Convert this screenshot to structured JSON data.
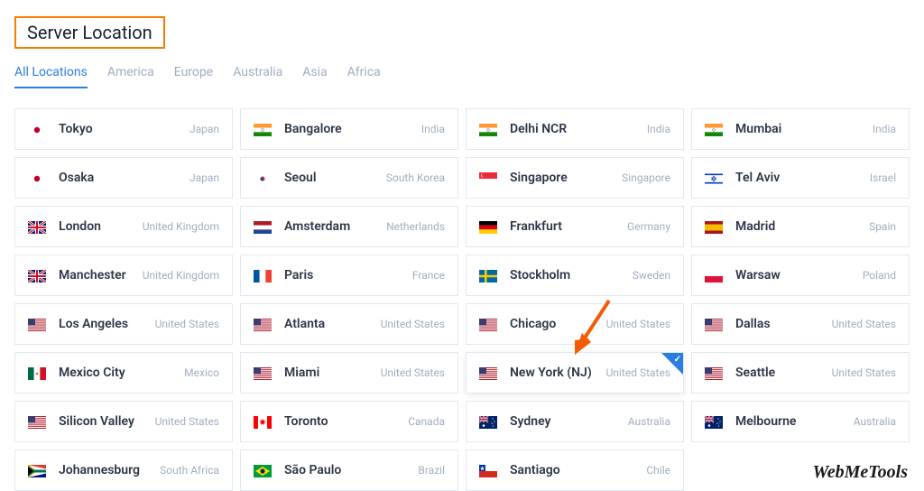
{
  "title": "Server Location",
  "tabs": [
    "All Locations",
    "America",
    "Europe",
    "Australia",
    "Asia",
    "Africa"
  ],
  "activeTab": 0,
  "selectedIndex": 17,
  "brand": "WebMeTools",
  "locations": [
    {
      "city": "Tokyo",
      "country": "Japan",
      "flag": "jp"
    },
    {
      "city": "Bangalore",
      "country": "India",
      "flag": "in"
    },
    {
      "city": "Delhi NCR",
      "country": "India",
      "flag": "in"
    },
    {
      "city": "Mumbai",
      "country": "India",
      "flag": "in"
    },
    {
      "city": "Osaka",
      "country": "Japan",
      "flag": "jp"
    },
    {
      "city": "Seoul",
      "country": "South Korea",
      "flag": "kr"
    },
    {
      "city": "Singapore",
      "country": "Singapore",
      "flag": "sg"
    },
    {
      "city": "Tel Aviv",
      "country": "Israel",
      "flag": "il"
    },
    {
      "city": "London",
      "country": "United Kingdom",
      "flag": "gb"
    },
    {
      "city": "Amsterdam",
      "country": "Netherlands",
      "flag": "nl"
    },
    {
      "city": "Frankfurt",
      "country": "Germany",
      "flag": "de"
    },
    {
      "city": "Madrid",
      "country": "Spain",
      "flag": "es"
    },
    {
      "city": "Manchester",
      "country": "United Kingdom",
      "flag": "gb"
    },
    {
      "city": "Paris",
      "country": "France",
      "flag": "fr"
    },
    {
      "city": "Stockholm",
      "country": "Sweden",
      "flag": "se"
    },
    {
      "city": "Warsaw",
      "country": "Poland",
      "flag": "pl"
    },
    {
      "city": "Los Angeles",
      "country": "United States",
      "flag": "us"
    },
    {
      "city": "Atlanta",
      "country": "United States",
      "flag": "us"
    },
    {
      "city": "Chicago",
      "country": "United States",
      "flag": "us"
    },
    {
      "city": "Dallas",
      "country": "United States",
      "flag": "us"
    },
    {
      "city": "Mexico City",
      "country": "Mexico",
      "flag": "mx"
    },
    {
      "city": "Miami",
      "country": "United States",
      "flag": "us"
    },
    {
      "city": "New York (NJ)",
      "country": "United States",
      "flag": "us"
    },
    {
      "city": "Seattle",
      "country": "United States",
      "flag": "us"
    },
    {
      "city": "Silicon Valley",
      "country": "United States",
      "flag": "us"
    },
    {
      "city": "Toronto",
      "country": "Canada",
      "flag": "ca"
    },
    {
      "city": "Sydney",
      "country": "Australia",
      "flag": "au"
    },
    {
      "city": "Melbourne",
      "country": "Australia",
      "flag": "au"
    },
    {
      "city": "Johannesburg",
      "country": "South Africa",
      "flag": "za"
    },
    {
      "city": "São Paulo",
      "country": "Brazil",
      "flag": "br"
    },
    {
      "city": "Santiago",
      "country": "Chile",
      "flag": "cl"
    }
  ]
}
